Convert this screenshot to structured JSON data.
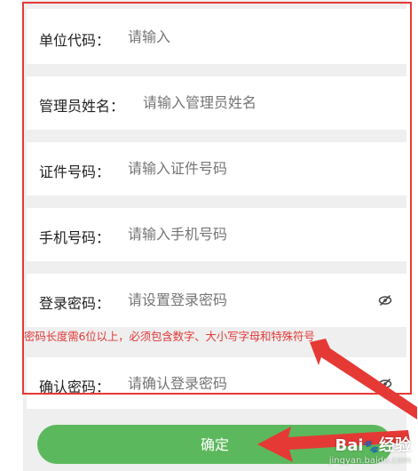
{
  "form": {
    "unit_code": {
      "label": "单位代码：",
      "placeholder": "请输入"
    },
    "admin_name": {
      "label": "管理员姓名：",
      "placeholder": "请输入管理员姓名"
    },
    "id_number": {
      "label": "证件号码：",
      "placeholder": "请输入证件号码"
    },
    "phone": {
      "label": "手机号码：",
      "placeholder": "请输入手机号码"
    },
    "login_password": {
      "label": "登录密码：",
      "placeholder": "请设置登录密码",
      "icon": "eye-hidden-icon"
    },
    "password_hint": "密码长度需6位以上，必须包含数字、大小写字母和特殊符号",
    "confirm_password": {
      "label": "确认密码：",
      "placeholder": "请确认登录密码",
      "icon": "eye-hidden-icon"
    },
    "submit_label": "确定"
  },
  "watermark": {
    "logo": "Bai",
    "logo_suffix": "经验",
    "url": "jingyan.baidu.com"
  },
  "colors": {
    "accent_green": "#5cb85c",
    "annotation_red": "#e53935",
    "hint_red": "#e03a3a",
    "page_background": "#efefef"
  }
}
